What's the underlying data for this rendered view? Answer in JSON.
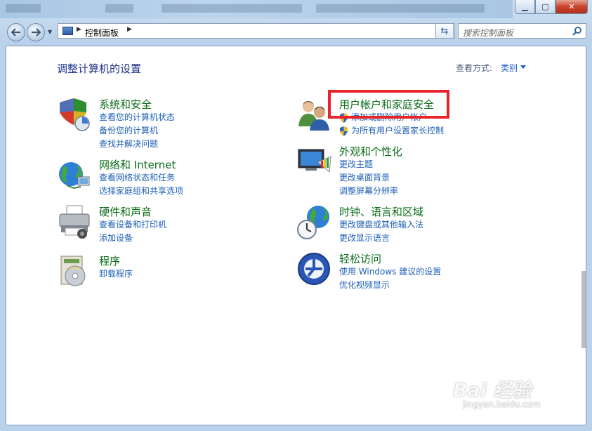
{
  "window": {
    "controls": {
      "minimize": "▁",
      "maximize": "▢",
      "close": "✕"
    }
  },
  "navbar": {
    "back_icon": "arrow-left-icon",
    "forward_icon": "arrow-right-icon",
    "address": {
      "separator": "▶",
      "path": "控制面板",
      "separator2": "▶",
      "dropdown": "▼"
    },
    "refresh_icon": "⇆",
    "search": {
      "placeholder": "搜索控制面板"
    }
  },
  "content": {
    "title": "调整计算机的设置",
    "view_by": {
      "label": "查看方式:",
      "value": "类别"
    },
    "categories": [
      {
        "title": "系统和安全",
        "icon": "system-security-icon",
        "links": [
          "查看您的计算机状态",
          "备份您的计算机",
          "查找并解决问题"
        ]
      },
      {
        "title": "网络和 Internet",
        "icon": "network-globe-icon",
        "links": [
          "查看网络状态和任务",
          "选择家庭组和共享选项"
        ]
      },
      {
        "title": "硬件和声音",
        "icon": "printer-icon",
        "links": [
          "查看设备和打印机",
          "添加设备"
        ]
      },
      {
        "title": "程序",
        "icon": "programs-icon",
        "links": [
          "卸载程序"
        ]
      },
      {
        "title": "用户帐户和家庭安全",
        "icon": "users-icon",
        "links": [
          "添加或删除用户帐户",
          "为所有用户设置家长控制"
        ]
      },
      {
        "title": "外观和个性化",
        "icon": "monitor-palette-icon",
        "links": [
          "更改主题",
          "更改桌面背景",
          "调整屏幕分辨率"
        ]
      },
      {
        "title": "时钟、语言和区域",
        "icon": "clock-globe-icon",
        "links": [
          "更改键盘或其他输入法",
          "更改显示语言"
        ]
      },
      {
        "title": "轻松访问",
        "icon": "ease-of-access-icon",
        "links": [
          "使用 Windows 建议的设置",
          "优化视频显示"
        ]
      }
    ]
  },
  "watermark": {
    "main": "Bai 经验",
    "sub": "jingyan.baidu.com"
  },
  "colors": {
    "link": "#1c5fb5",
    "category_title": "#0a6c18",
    "highlight": "#e8242a",
    "title": "#1e3287"
  }
}
